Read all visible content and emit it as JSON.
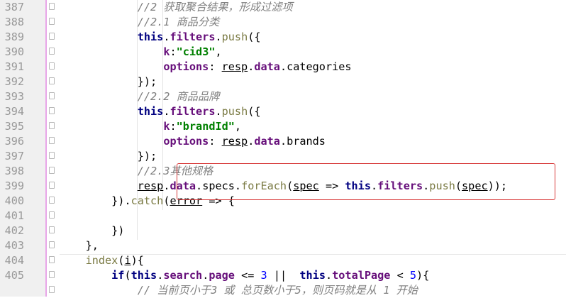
{
  "lines": [
    {
      "num": "387",
      "pre": "            ",
      "t": [
        {
          "c": "comment",
          "v": "//2 获取聚合结果，形成过滤项"
        }
      ]
    },
    {
      "num": "388",
      "pre": "            ",
      "t": [
        {
          "c": "comment",
          "v": "//2.1 商品分类"
        }
      ]
    },
    {
      "num": "389",
      "pre": "            ",
      "t": [
        {
          "c": "kw",
          "v": "this"
        },
        {
          "c": "",
          "v": "."
        },
        {
          "c": "prop",
          "v": "filters"
        },
        {
          "c": "",
          "v": "."
        },
        {
          "c": "fn",
          "v": "push"
        },
        {
          "c": "",
          "v": "({"
        }
      ]
    },
    {
      "num": "390",
      "pre": "                ",
      "t": [
        {
          "c": "prop",
          "v": "k"
        },
        {
          "c": "",
          "v": ":"
        },
        {
          "c": "str",
          "v": "\"cid3\""
        },
        {
          "c": "",
          "v": ","
        }
      ]
    },
    {
      "num": "391",
      "pre": "                ",
      "t": [
        {
          "c": "prop",
          "v": "options"
        },
        {
          "c": "",
          "v": ": "
        },
        {
          "c": "u",
          "v": "resp"
        },
        {
          "c": "",
          "v": "."
        },
        {
          "c": "prop",
          "v": "data"
        },
        {
          "c": "",
          "v": ".categories"
        }
      ]
    },
    {
      "num": "392",
      "pre": "            ",
      "t": [
        {
          "c": "",
          "v": "});"
        }
      ]
    },
    {
      "num": "393",
      "pre": "            ",
      "t": [
        {
          "c": "comment",
          "v": "//2.2 商品品牌"
        }
      ]
    },
    {
      "num": "394",
      "pre": "            ",
      "t": [
        {
          "c": "kw",
          "v": "this"
        },
        {
          "c": "",
          "v": "."
        },
        {
          "c": "prop",
          "v": "filters"
        },
        {
          "c": "",
          "v": "."
        },
        {
          "c": "fn",
          "v": "push"
        },
        {
          "c": "",
          "v": "({"
        }
      ]
    },
    {
      "num": "395",
      "pre": "                ",
      "t": [
        {
          "c": "prop",
          "v": "k"
        },
        {
          "c": "",
          "v": ":"
        },
        {
          "c": "str",
          "v": "\"brandId\""
        },
        {
          "c": "",
          "v": ","
        }
      ]
    },
    {
      "num": "396",
      "pre": "                ",
      "t": [
        {
          "c": "prop",
          "v": "options"
        },
        {
          "c": "",
          "v": ": "
        },
        {
          "c": "u",
          "v": "resp"
        },
        {
          "c": "",
          "v": "."
        },
        {
          "c": "prop",
          "v": "data"
        },
        {
          "c": "",
          "v": ".brands"
        }
      ]
    },
    {
      "num": "397",
      "pre": "            ",
      "t": [
        {
          "c": "",
          "v": "});"
        }
      ]
    },
    {
      "num": "398",
      "pre": "            ",
      "t": [
        {
          "c": "comment",
          "v": "//2.3其他规格"
        }
      ]
    },
    {
      "num": "399",
      "pre": "            ",
      "t": [
        {
          "c": "u",
          "v": "resp"
        },
        {
          "c": "",
          "v": "."
        },
        {
          "c": "prop",
          "v": "data"
        },
        {
          "c": "",
          "v": ".specs."
        },
        {
          "c": "fn",
          "v": "forEach"
        },
        {
          "c": "",
          "v": "("
        },
        {
          "c": "u",
          "v": "spec"
        },
        {
          "c": "",
          "v": " => "
        },
        {
          "c": "kw",
          "v": "this"
        },
        {
          "c": "",
          "v": "."
        },
        {
          "c": "prop",
          "v": "filters"
        },
        {
          "c": "",
          "v": "."
        },
        {
          "c": "fn",
          "v": "push"
        },
        {
          "c": "",
          "v": "("
        },
        {
          "c": "u",
          "v": "spec"
        },
        {
          "c": "",
          "v": "));"
        }
      ]
    },
    {
      "num": "400",
      "pre": "        ",
      "t": [
        {
          "c": "",
          "v": "})."
        },
        {
          "c": "fn",
          "v": "catch"
        },
        {
          "c": "",
          "v": "("
        },
        {
          "c": "u",
          "v": "error"
        },
        {
          "c": "",
          "v": " => {"
        }
      ]
    },
    {
      "num": "401",
      "pre": "",
      "t": []
    },
    {
      "num": "402",
      "pre": "        ",
      "t": [
        {
          "c": "",
          "v": "})"
        }
      ]
    },
    {
      "num": "403",
      "pre": "    ",
      "t": [
        {
          "c": "",
          "v": "},"
        }
      ]
    },
    {
      "num": "404",
      "pre": "    ",
      "t": [
        {
          "c": "fn",
          "v": "index"
        },
        {
          "c": "",
          "v": "("
        },
        {
          "c": "u",
          "v": "i"
        },
        {
          "c": "",
          "v": "){"
        }
      ]
    },
    {
      "num": "405",
      "pre": "        ",
      "t": [
        {
          "c": "kw",
          "v": "if"
        },
        {
          "c": "",
          "v": "("
        },
        {
          "c": "kw",
          "v": "this"
        },
        {
          "c": "",
          "v": "."
        },
        {
          "c": "prop",
          "v": "search"
        },
        {
          "c": "",
          "v": "."
        },
        {
          "c": "prop",
          "v": "page"
        },
        {
          "c": "",
          "v": " <= "
        },
        {
          "c": "num",
          "v": "3"
        },
        {
          "c": "",
          "v": " ||  "
        },
        {
          "c": "kw",
          "v": "this"
        },
        {
          "c": "",
          "v": "."
        },
        {
          "c": "prop",
          "v": "totalPage"
        },
        {
          "c": "",
          "v": " < "
        },
        {
          "c": "num",
          "v": "5"
        },
        {
          "c": "",
          "v": "){"
        }
      ]
    },
    {
      "num": "",
      "pre": "            ",
      "t": [
        {
          "c": "comment",
          "v": "// 当前页小于3 或 总页数小于5，则页码就是从 1 开始"
        }
      ]
    }
  ]
}
